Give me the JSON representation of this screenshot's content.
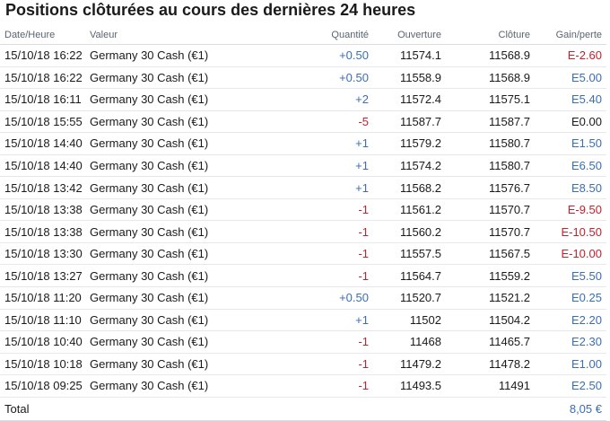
{
  "title": "Positions clôturées au cours des dernières 24 heures",
  "columns": {
    "date": "Date/Heure",
    "value": "Valeur",
    "quantity": "Quantité",
    "open": "Ouverture",
    "close": "Clôture",
    "gain": "Gain/perte"
  },
  "colors": {
    "positive": "#3a6fb0",
    "negative": "#c0222e",
    "neutral": "#1a1a1a"
  },
  "rows": [
    {
      "date": "15/10/18 16:22",
      "value": "Germany 30 Cash (€1)",
      "quantity": "+0.50",
      "open": "11574.1",
      "close": "11568.9",
      "gain": "E-2.60"
    },
    {
      "date": "15/10/18 16:22",
      "value": "Germany 30 Cash (€1)",
      "quantity": "+0.50",
      "open": "11558.9",
      "close": "11568.9",
      "gain": "E5.00"
    },
    {
      "date": "15/10/18 16:11",
      "value": "Germany 30 Cash (€1)",
      "quantity": "+2",
      "open": "11572.4",
      "close": "11575.1",
      "gain": "E5.40"
    },
    {
      "date": "15/10/18 15:55",
      "value": "Germany 30 Cash (€1)",
      "quantity": "-5",
      "open": "11587.7",
      "close": "11587.7",
      "gain": "E0.00"
    },
    {
      "date": "15/10/18 14:40",
      "value": "Germany 30 Cash (€1)",
      "quantity": "+1",
      "open": "11579.2",
      "close": "11580.7",
      "gain": "E1.50"
    },
    {
      "date": "15/10/18 14:40",
      "value": "Germany 30 Cash (€1)",
      "quantity": "+1",
      "open": "11574.2",
      "close": "11580.7",
      "gain": "E6.50"
    },
    {
      "date": "15/10/18 13:42",
      "value": "Germany 30 Cash (€1)",
      "quantity": "+1",
      "open": "11568.2",
      "close": "11576.7",
      "gain": "E8.50"
    },
    {
      "date": "15/10/18 13:38",
      "value": "Germany 30 Cash (€1)",
      "quantity": "-1",
      "open": "11561.2",
      "close": "11570.7",
      "gain": "E-9.50"
    },
    {
      "date": "15/10/18 13:38",
      "value": "Germany 30 Cash (€1)",
      "quantity": "-1",
      "open": "11560.2",
      "close": "11570.7",
      "gain": "E-10.50"
    },
    {
      "date": "15/10/18 13:30",
      "value": "Germany 30 Cash (€1)",
      "quantity": "-1",
      "open": "11557.5",
      "close": "11567.5",
      "gain": "E-10.00"
    },
    {
      "date": "15/10/18 13:27",
      "value": "Germany 30 Cash (€1)",
      "quantity": "-1",
      "open": "11564.7",
      "close": "11559.2",
      "gain": "E5.50"
    },
    {
      "date": "15/10/18 11:20",
      "value": "Germany 30 Cash (€1)",
      "quantity": "+0.50",
      "open": "11520.7",
      "close": "11521.2",
      "gain": "E0.25"
    },
    {
      "date": "15/10/18 11:10",
      "value": "Germany 30 Cash (€1)",
      "quantity": "+1",
      "open": "11502",
      "close": "11504.2",
      "gain": "E2.20"
    },
    {
      "date": "15/10/18 10:40",
      "value": "Germany 30 Cash (€1)",
      "quantity": "-1",
      "open": "11468",
      "close": "11465.7",
      "gain": "E2.30"
    },
    {
      "date": "15/10/18 10:18",
      "value": "Germany 30 Cash (€1)",
      "quantity": "-1",
      "open": "11479.2",
      "close": "11478.2",
      "gain": "E1.00"
    },
    {
      "date": "15/10/18 09:25",
      "value": "Germany 30 Cash (€1)",
      "quantity": "-1",
      "open": "11493.5",
      "close": "11491",
      "gain": "E2.50"
    }
  ],
  "total": {
    "label": "Total",
    "value": "8,05 €"
  }
}
